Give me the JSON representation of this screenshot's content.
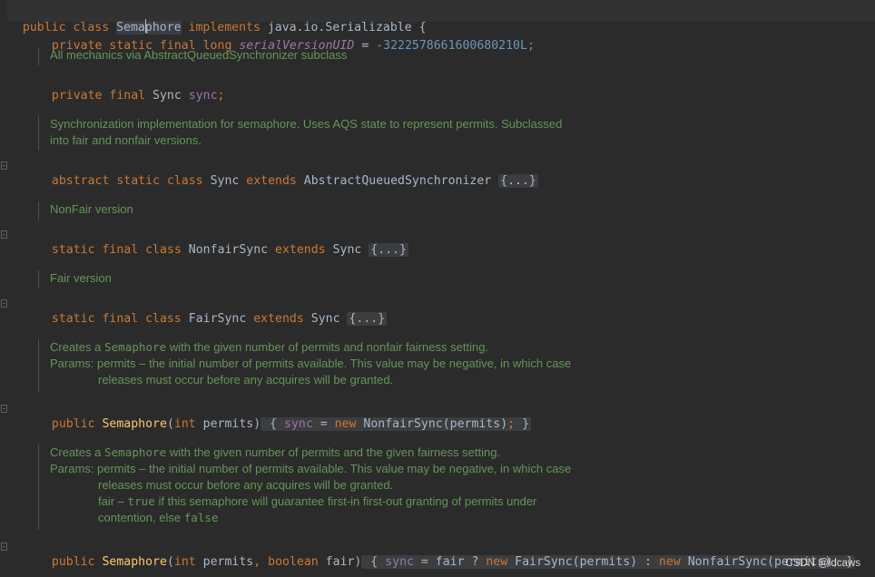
{
  "code": {
    "l1": {
      "t1": "public class ",
      "t2": "Sema",
      "t3": "phore",
      "t4": " implements ",
      "t5": "java.io.Serializable {"
    },
    "l2": {
      "t1": "private static final long ",
      "t2": "serialVersionUID",
      "t3": " = ",
      "t4": "-3222578661600680210L",
      "t5": ";"
    },
    "l3": {
      "t1": "private final ",
      "t2": "Sync ",
      "t3": "sync",
      "t4": ";"
    },
    "l4": {
      "t1": "abstract static class ",
      "t2": "Sync ",
      "t3": "extends ",
      "t4": "AbstractQueuedSynchronizer ",
      "fold": "{...}"
    },
    "l5": {
      "t1": "static final class ",
      "t2": "NonfairSync ",
      "t3": "extends ",
      "t4": "Sync ",
      "fold": "{...}"
    },
    "l6": {
      "t1": "static final class ",
      "t2": "FairSync ",
      "t3": "extends ",
      "t4": "Sync ",
      "fold": "{...}"
    },
    "l7": {
      "t1": "public ",
      "t2": "Semaphore",
      "t3": "(",
      "t4": "int ",
      "t5": "permits)",
      "t6": " { ",
      "t7": "sync",
      "t8": " = ",
      "t9": "new ",
      "t10": "NonfairSync(permits)",
      "t11": "; ",
      "t12": "}"
    },
    "l8": {
      "t1": "public ",
      "t2": "Semaphore",
      "t3": "(",
      "t4": "int ",
      "t5": "permits",
      "t6": ", ",
      "t7": "boolean ",
      "t8": "fair)",
      "t9": " { ",
      "t10": "sync",
      "t11": " = fair ? ",
      "t12": "new ",
      "t13": "FairSync(permits) : ",
      "t14": "new ",
      "t15": "NonfairSync(permits)",
      "t16": "; ",
      "t17": "}"
    }
  },
  "docs": {
    "d1": "All mechanics via AbstractQueuedSynchronizer subclass",
    "d2a": "Synchronization implementation for semaphore. Uses AQS state to represent permits. Subclassed",
    "d2b": "into fair and nonfair versions.",
    "d3": "NonFair version",
    "d4": "Fair version",
    "d5a1": "Creates a ",
    "d5a2": "Semaphore",
    "d5a3": " with the given number of permits and nonfair fairness setting.",
    "d5b": "Params: permits – the initial number of permits available. This value may be negative, in which case",
    "d5c": "releases must occur before any acquires will be granted.",
    "d6a1": "Creates a ",
    "d6a2": "Semaphore",
    "d6a3": " with the given number of permits and the given fairness setting.",
    "d6b": "Params: permits – the initial number of permits available. This value may be negative, in which case",
    "d6c": "releases must occur before any acquires will be granted.",
    "d6d1": "fair – ",
    "d6d2": "true",
    "d6d3": " if this semaphore will guarantee first-in first-out granting of permits under",
    "d6e1": "contention, else ",
    "d6e2": "false"
  },
  "watermark": "CSDN @ldcaws",
  "colors": {
    "background": "#2b2b2b",
    "keyword": "#cc7832",
    "doc": "#629755",
    "field": "#9876aa",
    "number": "#6897bb",
    "method": "#ffc66d"
  }
}
